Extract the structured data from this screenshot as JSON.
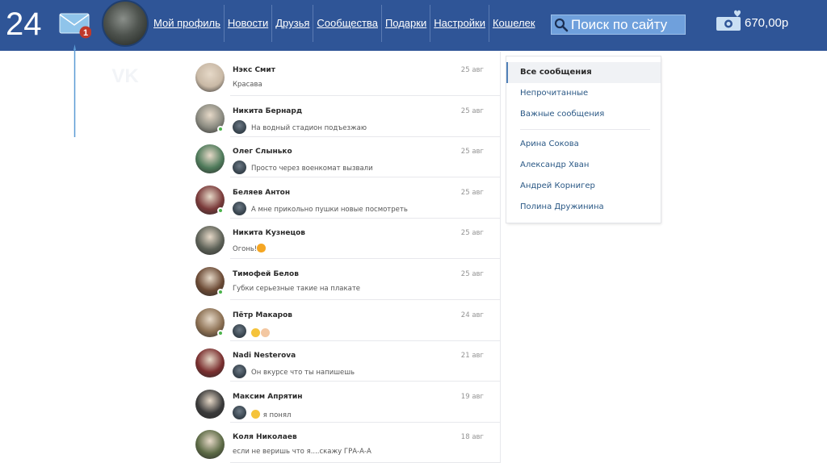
{
  "header": {
    "slide_number": "24",
    "mail_badge": "1",
    "nav": [
      "Мой профиль",
      "Новости",
      "Друзья",
      "Сообщества",
      "Подарки",
      "Настройки",
      "Кошелек"
    ],
    "search_label": "Поиск по сайту",
    "balance": "670,00р"
  },
  "colors": {
    "header": "#2f5597",
    "accent": "#5181b8",
    "online": "#4bb34b",
    "badge": "#c0392b"
  },
  "dialogs": [
    {
      "name": "Нэкс Смит",
      "date": "25 авг",
      "message": "Красава",
      "own": false,
      "online": false,
      "avatar": "#c9b9a6"
    },
    {
      "name": "Никита Бернард",
      "date": "25 авг",
      "message": "На водный стадион подъезжаю",
      "own": true,
      "online": true,
      "avatar": "#8a8a80"
    },
    {
      "name": "Олег Слынько",
      "date": "25 авг",
      "message": "Просто через военкомат вызвали",
      "own": true,
      "online": false,
      "avatar": "#4e7a5a"
    },
    {
      "name": "Беляев Антон",
      "date": "25 авг",
      "message": "А мне прикольно пушки новые посмотреть",
      "own": true,
      "online": true,
      "avatar": "#7a3a3a"
    },
    {
      "name": "Никита Кузнецов",
      "date": "25 авг",
      "message": "Огонь!",
      "own": false,
      "online": false,
      "avatar": "#5d6157",
      "emoji": [
        "fire"
      ]
    },
    {
      "name": "Тимофей Белов",
      "date": "25 авг",
      "message": "Губки серьезные такие на плакате",
      "own": false,
      "online": true,
      "avatar": "#6b4a35"
    },
    {
      "name": "Пётр Макаров",
      "date": "24 авг",
      "message": "",
      "own": true,
      "online": true,
      "avatar": "#8b6f52",
      "emoji": [
        "smile",
        "ok"
      ]
    },
    {
      "name": "Nadi Nesterova",
      "date": "21 авг",
      "message": "Он вкурсе что ты напишешь",
      "own": true,
      "online": false,
      "avatar": "#7a2f2f"
    },
    {
      "name": "Максим Апрятин",
      "date": "19 авг",
      "message": "я понял",
      "own": true,
      "online": false,
      "avatar": "#3a3a3a",
      "emoji": [
        "smile"
      ]
    },
    {
      "name": "Коля Николаев",
      "date": "18 авг",
      "message": "если не веришь что я....скажу ГРА-А-А",
      "own": false,
      "online": false,
      "avatar": "#5c6a45"
    }
  ],
  "sidebar": {
    "filters": [
      "Все сообщения",
      "Непрочитанные",
      "Важные сообщения"
    ],
    "contacts": [
      "Арина Сокова",
      "Александр Хван",
      "Андрей Корнигер",
      "Полина Дружинина"
    ]
  }
}
